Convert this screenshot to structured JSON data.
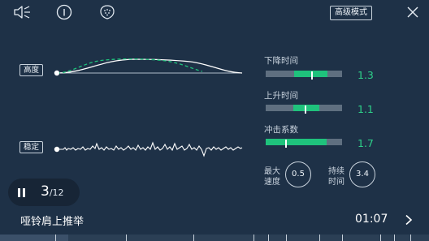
{
  "header": {
    "mode_button_label": "高级模式",
    "icons": [
      "speaker-muted-icon",
      "info-icon",
      "shield-icon",
      "close-icon"
    ]
  },
  "charts": {
    "height_tag": "高度",
    "stability_tag": "稳定"
  },
  "metrics": {
    "descent_time": {
      "label": "下降时间",
      "value": "1.3",
      "fill_start_pct": 37,
      "fill_end_pct": 81,
      "marker_pct": 60
    },
    "ascent_time": {
      "label": "上升时间",
      "value": "1.1",
      "fill_start_pct": 36,
      "fill_end_pct": 70,
      "marker_pct": 51
    },
    "impact_factor": {
      "label": "冲击系数",
      "value": "1.7",
      "fill_start_pct": 0,
      "fill_end_pct": 80,
      "marker_pct": 25
    },
    "max_speed": {
      "label": "最大速度",
      "value": "0.5"
    },
    "duration": {
      "label": "持续时间",
      "value": "3.4"
    }
  },
  "player": {
    "rep_current": "3",
    "rep_total": "/12",
    "exercise_name": "哑铃肩上推举",
    "elapsed": "01:07",
    "progress_pct": 16
  },
  "colors": {
    "background": "#1e3147",
    "accent_green": "#1fc27c",
    "value_green": "#2ed18a",
    "track": "#5f6f80"
  }
}
